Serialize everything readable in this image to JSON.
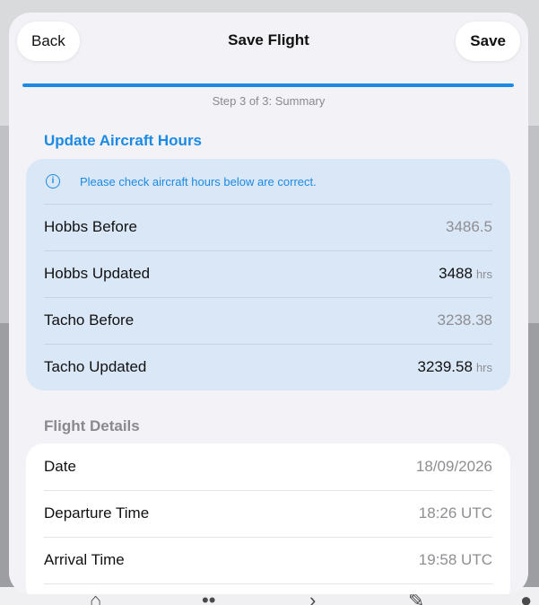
{
  "header": {
    "back_label": "Back",
    "title": "Save Flight",
    "save_label": "Save"
  },
  "progress": {
    "fraction": 1.0,
    "step_label": "Step 3 of 3: Summary"
  },
  "aircraft_hours": {
    "section_title": "Update Aircraft Hours",
    "info_icon": "info-icon",
    "info_text": "Please check aircraft hours below are correct.",
    "rows": [
      {
        "label": "Hobbs Before",
        "value": "3486.5",
        "unit": ""
      },
      {
        "label": "Hobbs Updated",
        "value": "3488",
        "unit": "hrs"
      },
      {
        "label": "Tacho Before",
        "value": "3238.38",
        "unit": ""
      },
      {
        "label": "Tacho Updated",
        "value": "3239.58",
        "unit": "hrs"
      }
    ]
  },
  "flight_details": {
    "section_title": "Flight Details",
    "rows": [
      {
        "label": "Date",
        "value": "18/09/2026"
      },
      {
        "label": "Departure Time",
        "value": "18:26 UTC"
      },
      {
        "label": "Arrival Time",
        "value": "19:58 UTC"
      }
    ]
  },
  "colors": {
    "accent": "#1a8ae5",
    "hours_card_bg": "#d9e7f7",
    "sheet_bg": "#f2f2f7"
  }
}
